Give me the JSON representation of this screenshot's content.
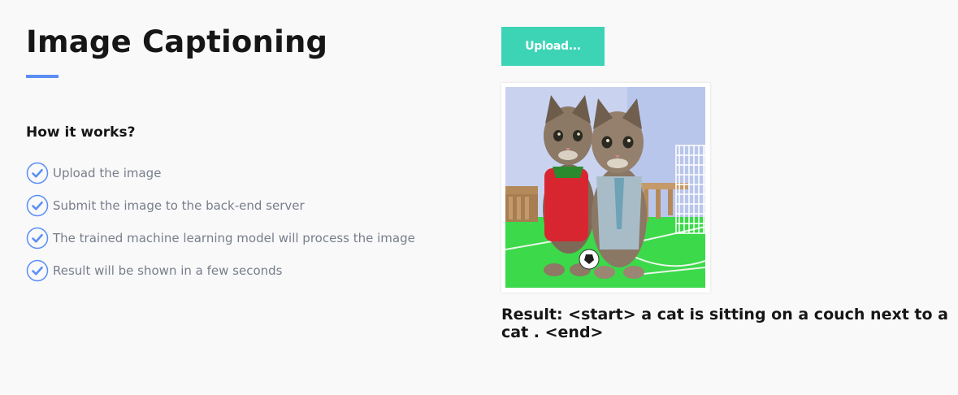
{
  "header": {
    "title": "Image Captioning"
  },
  "how_it_works": {
    "heading": "How it works?",
    "steps": [
      {
        "label": "Upload the image",
        "icon": "check-circle-icon"
      },
      {
        "label": "Submit the image to the back-end server",
        "icon": "check-circle-icon"
      },
      {
        "label": "The trained machine learning model will process the image",
        "icon": "check-circle-icon"
      },
      {
        "label": "Result will be shown in a few seconds",
        "icon": "check-circle-icon"
      }
    ]
  },
  "upload": {
    "button_label": "Upload..."
  },
  "result": {
    "text": "Result: <start> a cat is sitting on a couch next to a cat . <end>"
  },
  "colors": {
    "accent_blue": "#5b8ff5",
    "upload_button": "#3dd4b6",
    "heading_text": "#161616",
    "step_text": "#777e8a"
  }
}
